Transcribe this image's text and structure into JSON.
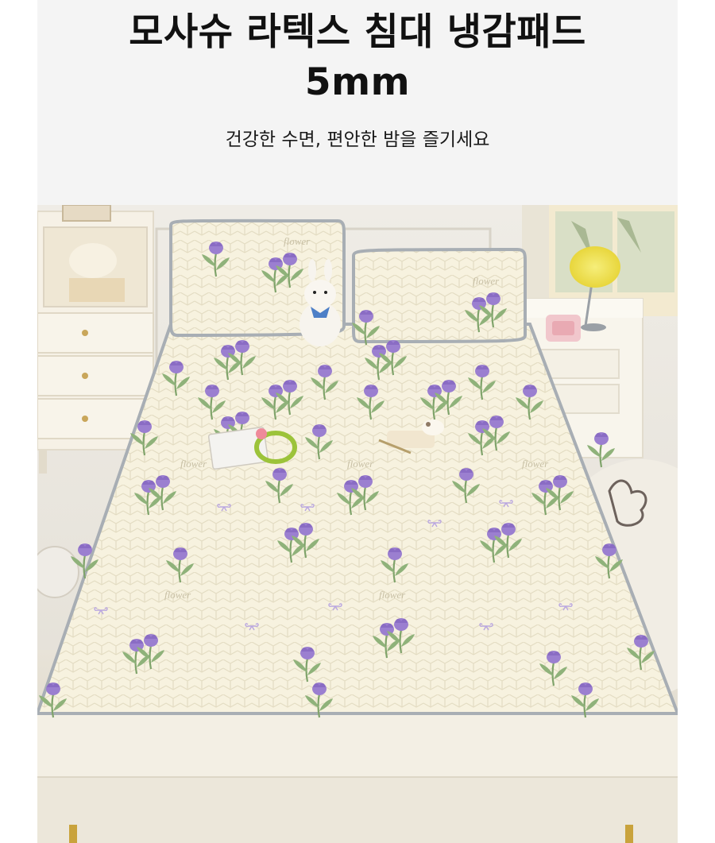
{
  "header": {
    "title_line1": "모사슈 라텍스 침대 냉감패드",
    "title_line2": "5mm",
    "subtitle": "건강한 수면, 편안한 밤을 즐기세요"
  },
  "photo": {
    "pad_words": [
      "flower",
      "flower",
      "flower",
      "flower",
      "flower",
      "flower",
      "flower"
    ]
  },
  "colors": {
    "header_bg": "#f4f4f4",
    "pad_base": "#f7f2df",
    "tulip_purple": "#9b7fd0",
    "leaf_green": "#7fa36a",
    "wall": "#ece9e2",
    "piping_gray": "#a8aeb4"
  }
}
